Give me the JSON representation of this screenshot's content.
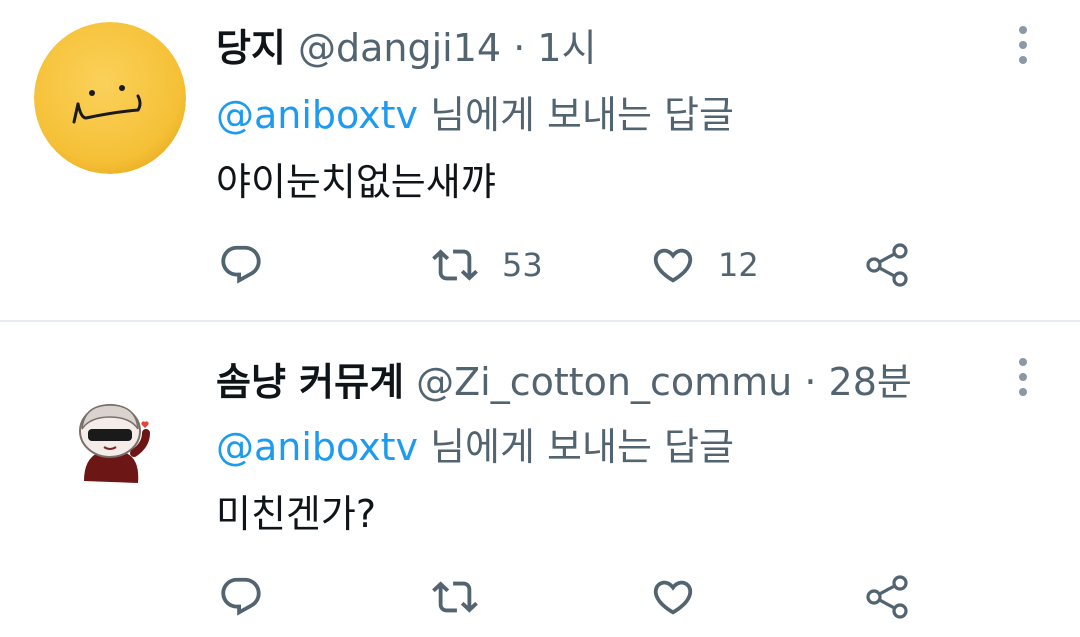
{
  "tweets": [
    {
      "name": "당지",
      "handle": "@dangji14",
      "separator": "·",
      "time": "1시",
      "reply_to": "@aniboxtv",
      "reply_suffix": " 님에게 보내는 답글",
      "text": "야이눈치없는새꺄",
      "retweets": "53",
      "likes": "12",
      "avatar_icon": "yellow-smiley-avatar"
    },
    {
      "name": "솜냥 커뮤계",
      "handle": "@Zi_cotton_commu",
      "separator": "·",
      "time": "28분",
      "reply_to": "@aniboxtv",
      "reply_suffix": " 님에게 보내는 답글",
      "text": "미친겐가?",
      "retweets": "",
      "likes": "",
      "avatar_icon": "moon-character-avatar"
    }
  ],
  "icons": {
    "reply": "reply-icon",
    "retweet": "retweet-icon",
    "like": "heart-icon",
    "share": "share-icon",
    "more": "more-vertical-icon"
  },
  "colors": {
    "mention": "#1d9bf0",
    "secondary_text": "#536471",
    "primary_text": "#0f1419",
    "divider": "#e6ecf0"
  }
}
